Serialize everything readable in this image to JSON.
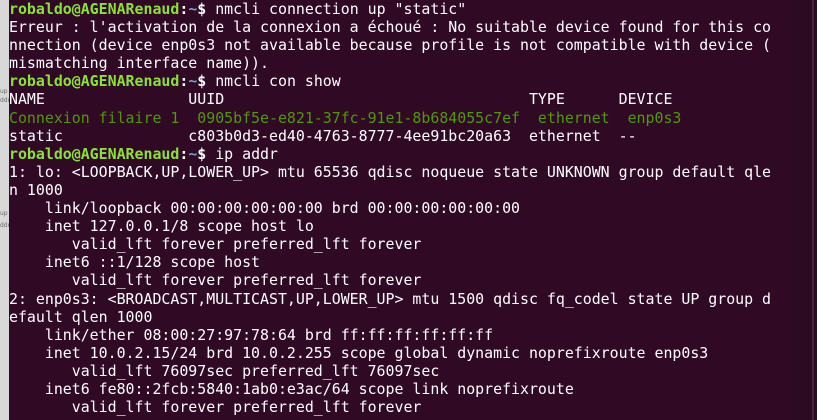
{
  "background_window": {
    "fragments": [
      "up",
      "ddr",
      "up",
      "ddr"
    ]
  },
  "prompt": {
    "user_host": "robaldo@AGENARenaud",
    "separator": ":",
    "path": "~",
    "symbol": "$"
  },
  "commands": [
    "nmcli connection up \"static\"",
    "nmcli con show",
    "ip addr"
  ],
  "error_lines": [
    "Erreur : l'activation de la connexion a échoué : No suitable device found for this co",
    "nnection (device enp0s3 not available because profile is not compatible with device (",
    "mismatching interface name))."
  ],
  "con_show": {
    "header": "NAME                UUID                                  TYPE      DEVICE",
    "rows": [
      "Connexion filaire 1  0905bf5e-e821-37fc-91e1-8b684055c7ef  ethernet  enp0s3",
      "static              c803b0d3-ed40-4763-8777-4ee91bc20a63  ethernet  --"
    ]
  },
  "ip_addr": [
    "1: lo: <LOOPBACK,UP,LOWER_UP> mtu 65536 qdisc noqueue state UNKNOWN group default qle",
    "n 1000",
    "    link/loopback 00:00:00:00:00:00 brd 00:00:00:00:00:00",
    "    inet 127.0.0.1/8 scope host lo",
    "       valid_lft forever preferred_lft forever",
    "    inet6 ::1/128 scope host",
    "       valid_lft forever preferred_lft forever",
    "2: enp0s3: <BROADCAST,MULTICAST,UP,LOWER_UP> mtu 1500 qdisc fq_codel state UP group d",
    "efault qlen 1000",
    "    link/ether 08:00:27:97:78:64 brd ff:ff:ff:ff:ff:ff",
    "    inet 10.0.2.15/24 brd 10.0.2.255 scope global dynamic noprefixroute enp0s3",
    "       valid_lft 76097sec preferred_lft 76097sec",
    "    inet6 fe80::2fcb:5840:1ab0:e3ac/64 scope link noprefixroute",
    "       valid_lft forever preferred_lft forever"
  ],
  "colors": {
    "background": "#300a24",
    "prompt_user": "#8ae234",
    "prompt_path": "#729fcf",
    "active_connection": "#4e9a06",
    "text": "#ffffff"
  },
  "icons": {
    "cursor": "block-cursor-icon"
  }
}
